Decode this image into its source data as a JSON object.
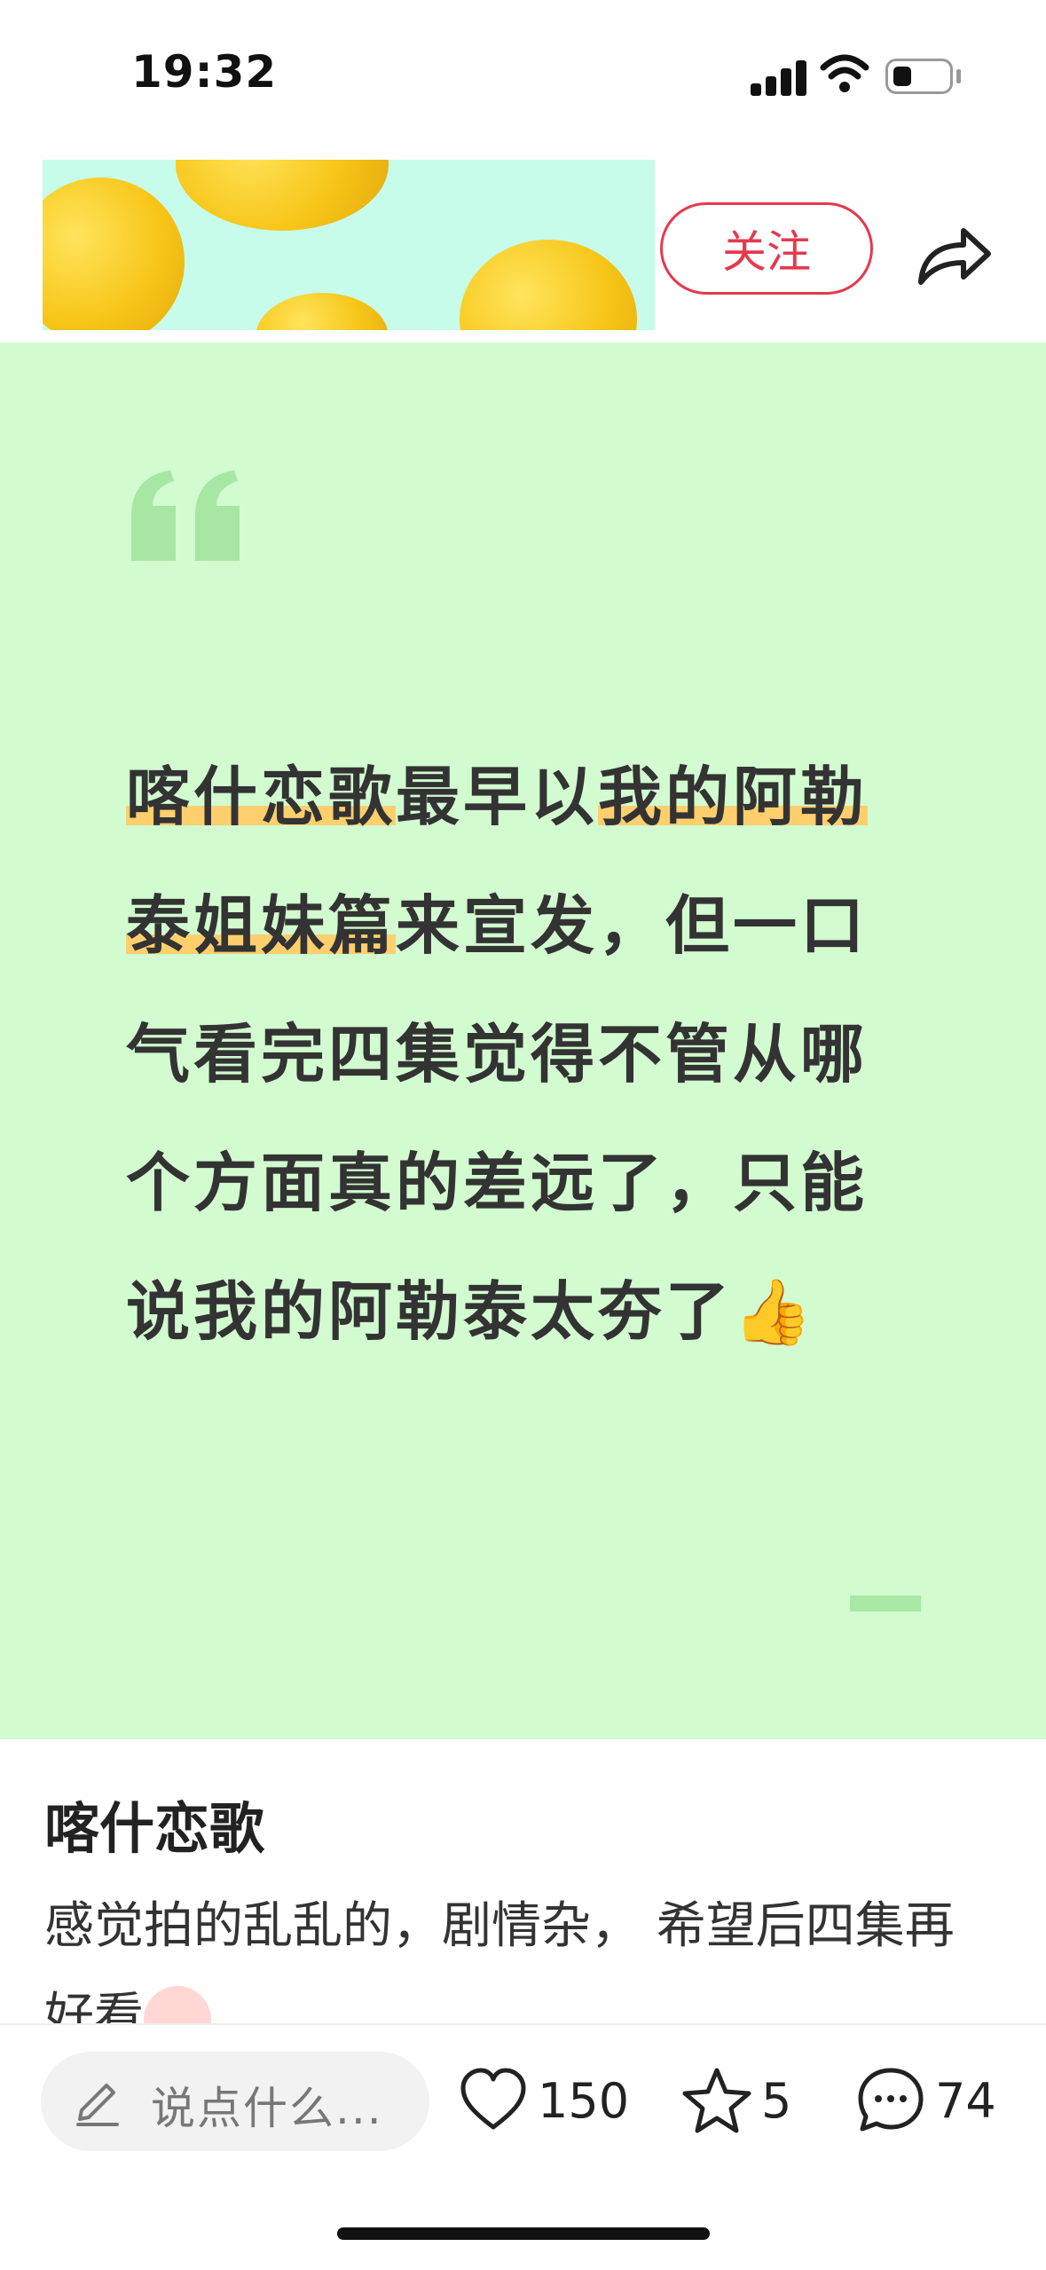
{
  "status_bar": {
    "time": "19:32"
  },
  "header": {
    "follow_label": "关注"
  },
  "quote": {
    "segments": [
      {
        "text": "喀什恋歌",
        "highlight": true
      },
      {
        "text": "最早以",
        "highlight": false
      },
      {
        "text": "我的阿勒泰姐妹篇",
        "highlight": true
      },
      {
        "text": "来宣发，但一口气看完四集觉得不管从哪个方面真的差远了，只能说我的阿勒泰太夯了",
        "highlight": false
      }
    ],
    "emoji": "👍"
  },
  "post": {
    "title": "喀什恋歌",
    "body": "感觉拍的乱乱的，剧情杂， 希望后四集再好看"
  },
  "bottom_bar": {
    "comment_placeholder": "说点什么...",
    "like_count": "150",
    "favorite_count": "5",
    "comment_count": "74"
  },
  "colors": {
    "accent_red": "#e33a4e",
    "card_green": "#d2fbd0",
    "highlight_yellow": "#ffcf6e"
  }
}
